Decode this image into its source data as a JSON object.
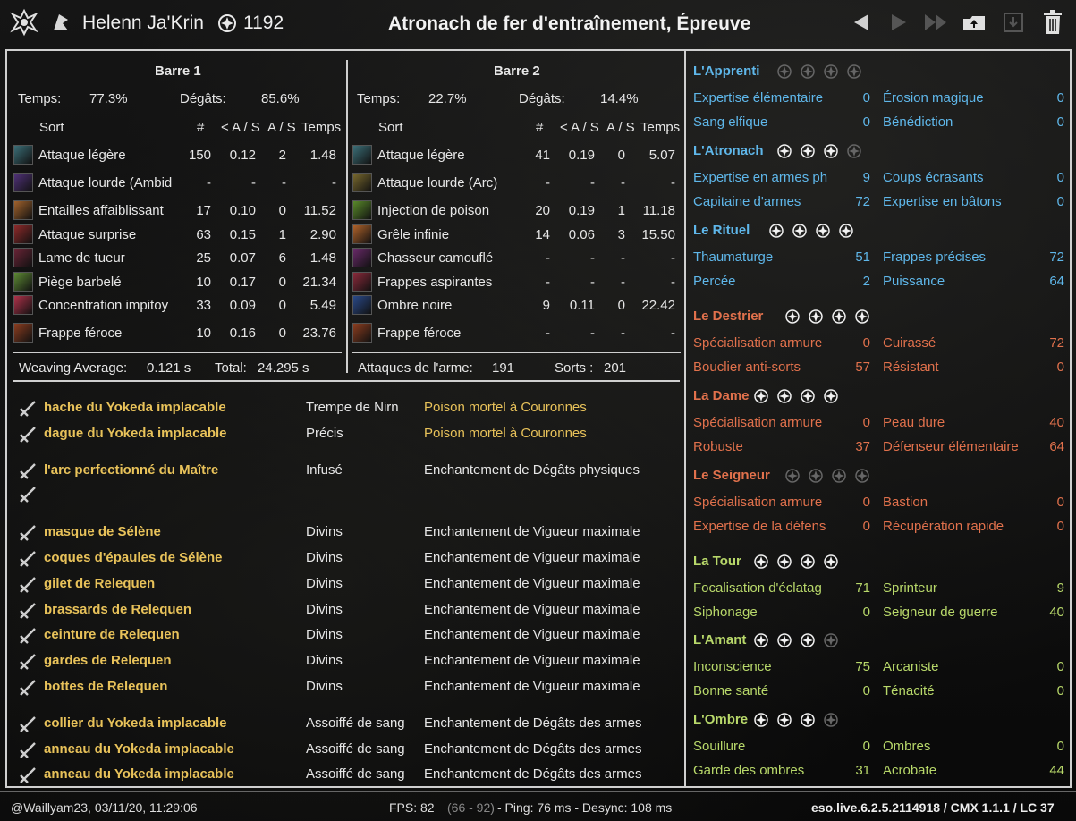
{
  "header": {
    "character_name": "Helenn Ja'Krin",
    "champion_points": "1192",
    "title": "Atronach de fer d'entraînement, Épreuve",
    "icons": [
      "guild-logo-icon",
      "class-icon",
      "champion-point-icon",
      "prev-icon",
      "next-icon",
      "skip-icon",
      "upload-icon",
      "export-icon",
      "delete-icon"
    ]
  },
  "bar1": {
    "title": "Barre 1",
    "time_label": "Temps:",
    "time_value": "77.3%",
    "dmg_label": "Dégâts:",
    "dmg_value": "85.6%",
    "columns": [
      "Sort",
      "#",
      "< A / S",
      "A / S",
      "Temps"
    ],
    "rows": [
      {
        "name": "Attaque légère",
        "count": "150",
        "lt": "0.12",
        "as": "2",
        "time": "1.48",
        "color": "#3b6f78"
      },
      {
        "name": "Attaque lourde (Ambid",
        "count": "-",
        "lt": "-",
        "as": "-",
        "time": "-",
        "color": "#51327a"
      },
      {
        "name": "Entailles affaiblissant",
        "count": "17",
        "lt": "0.10",
        "as": "0",
        "time": "11.52",
        "color": "#a1622c"
      },
      {
        "name": "Attaque surprise",
        "count": "63",
        "lt": "0.15",
        "as": "1",
        "time": "2.90",
        "color": "#8e2a2a"
      },
      {
        "name": "Lame de tueur",
        "count": "25",
        "lt": "0.07",
        "as": "6",
        "time": "1.48",
        "color": "#6a2436"
      },
      {
        "name": "Piège barbelé",
        "count": "10",
        "lt": "0.17",
        "as": "0",
        "time": "21.34",
        "color": "#5e8a34"
      },
      {
        "name": "Concentration impitoy",
        "count": "33",
        "lt": "0.09",
        "as": "0",
        "time": "5.49",
        "color": "#b0324a"
      },
      {
        "name": "Frappe féroce",
        "count": "10",
        "lt": "0.16",
        "as": "0",
        "time": "23.76",
        "color": "#8c3d1f"
      }
    ],
    "weaving_label": "Weaving Average:",
    "weaving_value": "0.121 s",
    "total_label": "Total:",
    "total_value": "24.295 s"
  },
  "bar2": {
    "title": "Barre 2",
    "time_label": "Temps:",
    "time_value": "22.7%",
    "dmg_label": "Dégâts:",
    "dmg_value": "14.4%",
    "columns": [
      "Sort",
      "#",
      "< A / S",
      "A / S",
      "Temps"
    ],
    "rows": [
      {
        "name": "Attaque légère",
        "count": "41",
        "lt": "0.19",
        "as": "0",
        "time": "5.07",
        "color": "#3b6f78"
      },
      {
        "name": "Attaque lourde (Arc)",
        "count": "-",
        "lt": "-",
        "as": "-",
        "time": "-",
        "color": "#7a6a2e"
      },
      {
        "name": "Injection de poison",
        "count": "20",
        "lt": "0.19",
        "as": "1",
        "time": "11.18",
        "color": "#5a8a2a"
      },
      {
        "name": "Grêle infinie",
        "count": "14",
        "lt": "0.06",
        "as": "3",
        "time": "15.50",
        "color": "#b0622a"
      },
      {
        "name": "Chasseur camouflé",
        "count": "-",
        "lt": "-",
        "as": "-",
        "time": "-",
        "color": "#6a2a6a"
      },
      {
        "name": "Frappes aspirantes",
        "count": "-",
        "lt": "-",
        "as": "-",
        "time": "-",
        "color": "#8a2a3a"
      },
      {
        "name": "Ombre noire",
        "count": "9",
        "lt": "0.11",
        "as": "0",
        "time": "22.42",
        "color": "#2a4a8a"
      },
      {
        "name": "Frappe féroce",
        "count": "-",
        "lt": "-",
        "as": "-",
        "time": "-",
        "color": "#8c3d1f"
      }
    ],
    "weapon_attacks_label": "Attaques de l'arme:",
    "weapon_attacks_value": "191",
    "spells_label": "Sorts :",
    "spells_value": "201"
  },
  "gear": [
    {
      "item": "hache du Yokeda implacable",
      "trait": "Trempe de Nirn",
      "enchant": "Poison mortel à Couronnes",
      "enchant_gold": true,
      "icon": "axe-icon"
    },
    {
      "item": "dague du Yokeda implacable",
      "trait": "Précis",
      "enchant": "Poison mortel à Couronnes",
      "enchant_gold": true,
      "icon": "dagger-icon"
    },
    {
      "item": "l'arc perfectionné du Maître",
      "trait": "Infusé",
      "enchant": "Enchantement de Dégâts physiques",
      "enchant_gold": false,
      "icon": "bow-icon"
    },
    {
      "item": "",
      "trait": "",
      "enchant": "",
      "enchant_gold": false,
      "icon": "empty-slot-icon"
    },
    {
      "item": "masque de Sélène",
      "trait": "Divins",
      "enchant": "Enchantement de Vigueur maximale",
      "enchant_gold": false,
      "icon": "helmet-icon"
    },
    {
      "item": "coques d'épaules de Sélène",
      "trait": "Divins",
      "enchant": "Enchantement de Vigueur maximale",
      "enchant_gold": false,
      "icon": "shoulder-icon"
    },
    {
      "item": "gilet de Relequen",
      "trait": "Divins",
      "enchant": "Enchantement de Vigueur maximale",
      "enchant_gold": false,
      "icon": "chest-icon"
    },
    {
      "item": "brassards de Relequen",
      "trait": "Divins",
      "enchant": "Enchantement de Vigueur maximale",
      "enchant_gold": false,
      "icon": "bracers-icon"
    },
    {
      "item": "ceinture de Relequen",
      "trait": "Divins",
      "enchant": "Enchantement de Vigueur maximale",
      "enchant_gold": false,
      "icon": "belt-icon"
    },
    {
      "item": "gardes de Relequen",
      "trait": "Divins",
      "enchant": "Enchantement de Vigueur maximale",
      "enchant_gold": false,
      "icon": "legs-icon"
    },
    {
      "item": "bottes de Relequen",
      "trait": "Divins",
      "enchant": "Enchantement de Vigueur maximale",
      "enchant_gold": false,
      "icon": "boots-icon"
    },
    {
      "item": "collier du Yokeda implacable",
      "trait": "Assoiffé de sang",
      "enchant": "Enchantement de Dégâts des armes",
      "enchant_gold": false,
      "icon": "necklace-icon"
    },
    {
      "item": "anneau du Yokeda implacable",
      "trait": "Assoiffé de sang",
      "enchant": "Enchantement de Dégâts des armes",
      "enchant_gold": false,
      "icon": "ring-icon"
    },
    {
      "item": "anneau du Yokeda implacable",
      "trait": "Assoiffé de sang",
      "enchant": "Enchantement de Dégâts des armes",
      "enchant_gold": false,
      "icon": "ring-icon"
    }
  ],
  "constellations": [
    {
      "name": "L'Apprenti",
      "tone": "blue",
      "stars": [
        0,
        0,
        0,
        0
      ],
      "perks": [
        [
          "Expertise élémentaire",
          "0",
          "Érosion magique",
          "0"
        ],
        [
          "Sang elfique",
          "0",
          "Bénédiction",
          "0"
        ]
      ]
    },
    {
      "name": "L'Atronach",
      "tone": "blue",
      "stars": [
        1,
        1,
        1,
        0
      ],
      "perks": [
        [
          "Expertise en armes ph",
          "9",
          "Coups écrasants",
          "0"
        ],
        [
          "Capitaine d'armes",
          "72",
          "Expertise en bâtons",
          "0"
        ]
      ]
    },
    {
      "name": "Le Rituel",
      "tone": "blue",
      "stars": [
        1,
        1,
        1,
        1
      ],
      "perks": [
        [
          "Thaumaturge",
          "51",
          "Frappes précises",
          "72"
        ],
        [
          "Percée",
          "2",
          "Puissance",
          "64"
        ]
      ]
    },
    {
      "name": "Le Destrier",
      "tone": "red",
      "stars": [
        1,
        1,
        1,
        1
      ],
      "perks": [
        [
          "Spécialisation armure",
          "0",
          "Cuirassé",
          "72"
        ],
        [
          "Bouclier anti-sorts",
          "57",
          "Résistant",
          "0"
        ]
      ]
    },
    {
      "name": "La Dame",
      "tone": "red",
      "stars": [
        1,
        1,
        1,
        1
      ],
      "perks": [
        [
          "Spécialisation armure",
          "0",
          "Peau dure",
          "40"
        ],
        [
          "Robuste",
          "37",
          "Défenseur élémentaire",
          "64"
        ]
      ]
    },
    {
      "name": "Le Seigneur",
      "tone": "red",
      "stars": [
        0,
        0,
        0,
        0
      ],
      "perks": [
        [
          "Spécialisation armure",
          "0",
          "Bastion",
          "0"
        ],
        [
          "Expertise de la défens",
          "0",
          "Récupération rapide",
          "0"
        ]
      ]
    },
    {
      "name": "La Tour",
      "tone": "green",
      "stars": [
        1,
        1,
        1,
        1
      ],
      "perks": [
        [
          "Focalisation d'éclatag",
          "71",
          "Sprinteur",
          "9"
        ],
        [
          "Siphonage",
          "0",
          "Seigneur de guerre",
          "40"
        ]
      ]
    },
    {
      "name": "L'Amant",
      "tone": "green",
      "stars": [
        1,
        1,
        1,
        0
      ],
      "perks": [
        [
          "Inconscience",
          "75",
          "Arcaniste",
          "0"
        ],
        [
          "Bonne santé",
          "0",
          "Ténacité",
          "0"
        ]
      ]
    },
    {
      "name": "L'Ombre",
      "tone": "green",
      "stars": [
        1,
        1,
        1,
        0
      ],
      "perks": [
        [
          "Souillure",
          "0",
          "Ombres",
          "0"
        ],
        [
          "Garde des ombres",
          "31",
          "Acrobate",
          "44"
        ]
      ]
    }
  ],
  "footer": {
    "left": "@Waillyam23, 03/11/20, 11:29:06",
    "fps_label": "FPS: 82",
    "fps_range": "(66 - 92)",
    "ping": "- Ping: 76 ms - Desync: 108 ms",
    "version": "eso.live.6.2.5.2114918 / CMX 1.1.1 / LC 37"
  }
}
